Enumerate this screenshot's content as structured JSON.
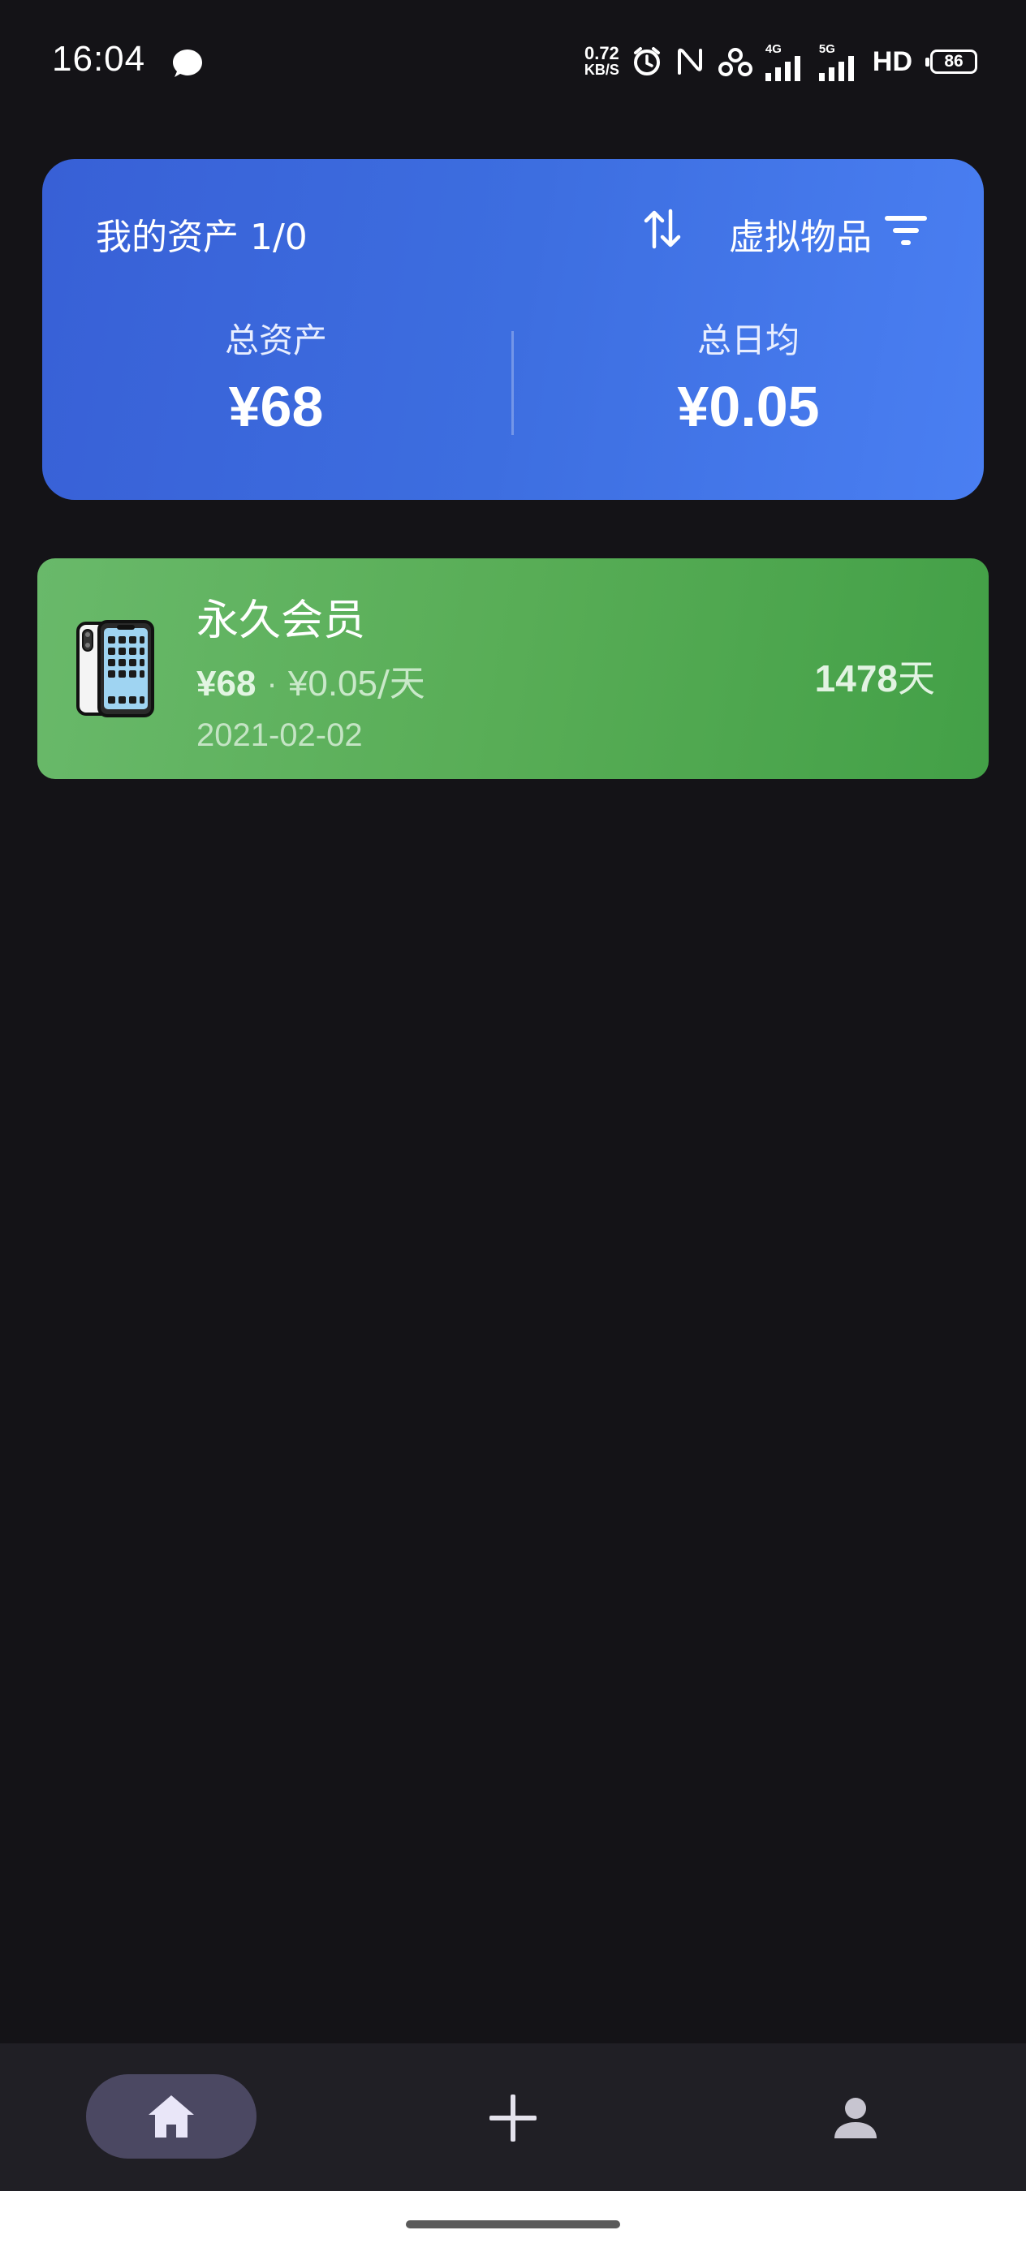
{
  "status_bar": {
    "time": "16:04",
    "net_speed_value": "0.72",
    "net_speed_unit": "KB/S",
    "signal1_label": "4G",
    "signal2_label": "5G",
    "hd_label": "HD",
    "battery_level": "86",
    "icons": [
      "chat-bubble-icon",
      "alarm-icon",
      "nfc-icon",
      "hotspot-icon",
      "signal-icon",
      "battery-icon"
    ]
  },
  "summary": {
    "title": "我的资产 1/0",
    "filter_label": "虚拟物品",
    "total_assets_label": "总资产",
    "total_assets_value": "¥68",
    "daily_avg_label": "总日均",
    "daily_avg_value": "¥0.05",
    "colors": {
      "card_start": "#3860d6",
      "card_end": "#4a7ff2"
    }
  },
  "assets": [
    {
      "name": "永久会员",
      "price": "¥68",
      "separator": "·",
      "daily": "¥0.05",
      "daily_unit": "/天",
      "date": "2021-02-02",
      "days_num": "1478",
      "days_unit": "天",
      "icon": "phone-illustration-icon",
      "color": "#58ad56"
    }
  ],
  "nav": {
    "items": [
      {
        "id": "home",
        "icon": "home-icon",
        "active": true
      },
      {
        "id": "add",
        "icon": "plus-icon",
        "active": false
      },
      {
        "id": "profile",
        "icon": "person-icon",
        "active": false
      }
    ],
    "colors": {
      "bar": "#201f25",
      "active_pill": "#4b4862"
    }
  }
}
